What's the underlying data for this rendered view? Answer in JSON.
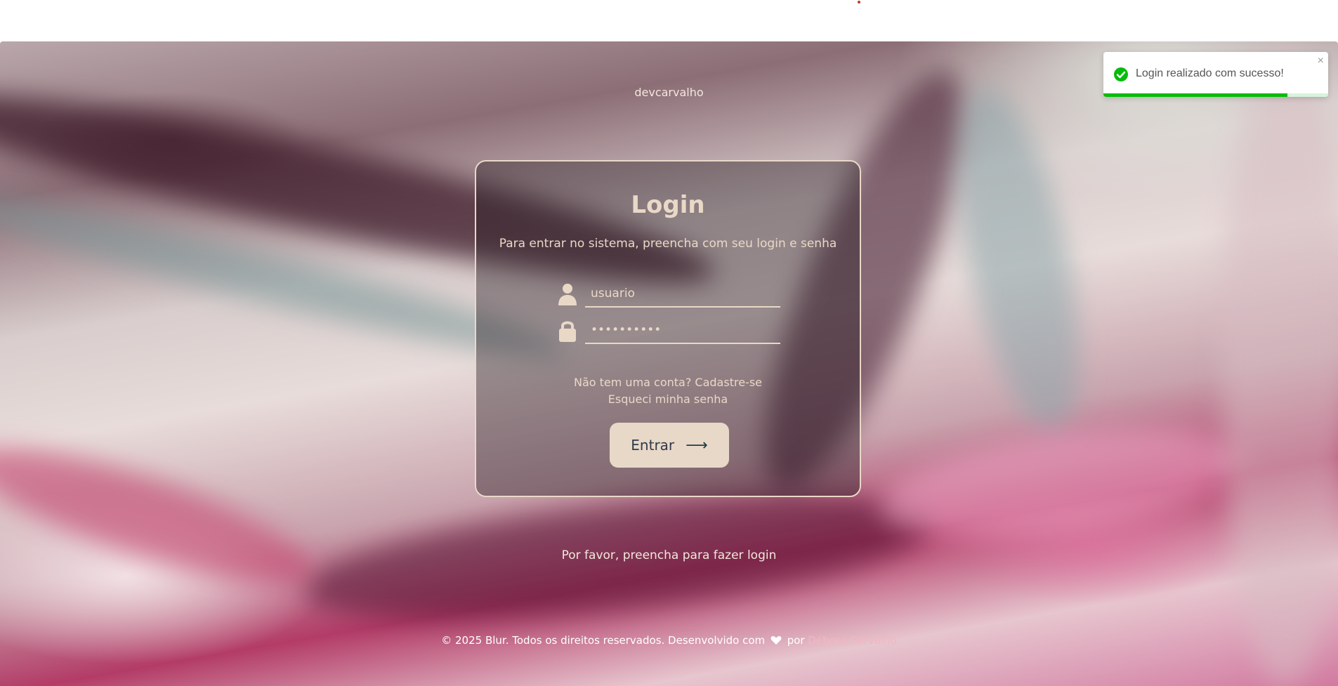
{
  "brand": "devcarvalho",
  "login": {
    "title": "Login",
    "subtitle": "Para entrar no sistema, preencha com seu login e senha",
    "username_placeholder": "usuario",
    "password_value": "••••••••••",
    "signup_link": "Não tem uma conta? Cadastre-se",
    "forgot_link": "Esqueci minha senha",
    "submit_label": "Entrar",
    "submit_icon": "arrow-right-icon"
  },
  "hint": "Por favor, preencha para fazer login",
  "footer": {
    "text": "© 2025 Blur. Todos os direitos reservados. Desenvolvido com",
    "heart_icon": "heart-icon",
    "by": "por",
    "author": "Débora Carvalho"
  },
  "toast": {
    "message": "Login realizado com sucesso!",
    "close_label": "×",
    "icon": "check-circle-icon",
    "progress": 0.82,
    "color": "#07bc0c"
  }
}
